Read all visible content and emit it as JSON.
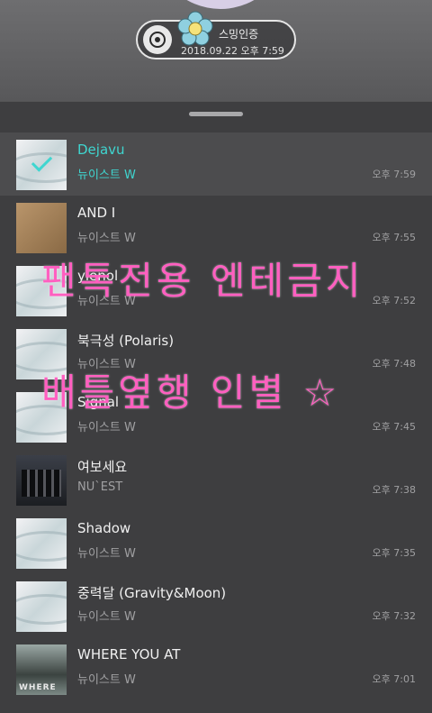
{
  "header": {
    "pill_title": "스밍인증",
    "pill_date": "2018.09.22 오후 7:59",
    "record_icon": "record-disc-icon",
    "sticker_icon": "flower-sticker-icon"
  },
  "playlist": [
    {
      "title": "Dejavu",
      "artist": "뉴이스트 W",
      "time": "오후 7:59",
      "cover": "white",
      "selected": true
    },
    {
      "title": "AND I",
      "artist": "뉴이스트 W",
      "time": "오후 7:55",
      "cover": "brown"
    },
    {
      "title": "ylenol",
      "artist": "뉴이스트 W",
      "time": "오후 7:52",
      "cover": "white"
    },
    {
      "title": "북극성 (Polaris)",
      "artist": "뉴이스트 W",
      "time": "오후 7:48",
      "cover": "white"
    },
    {
      "title": "Signal",
      "artist": "뉴이스트 W",
      "time": "오후 7:45",
      "cover": "white"
    },
    {
      "title": "여보세요",
      "artist": "NU`EST",
      "time": "오후 7:38",
      "cover": "dark"
    },
    {
      "title": "Shadow",
      "artist": "뉴이스트 W",
      "time": "오후 7:35",
      "cover": "white"
    },
    {
      "title": "중력달 (Gravity&Moon)",
      "artist": "뉴이스트 W",
      "time": "오후 7:32",
      "cover": "white"
    },
    {
      "title": "WHERE YOU AT",
      "artist": "뉴이스트 W",
      "time": "오후 7:01",
      "cover": "poster"
    }
  ],
  "overlay": {
    "line1": "팬톡전용  엔테금지",
    "line2": "배틀옆행 인별 ☆"
  },
  "colors": {
    "accent": "#3fd6d0",
    "overlay_text": "#ff5fc0"
  }
}
